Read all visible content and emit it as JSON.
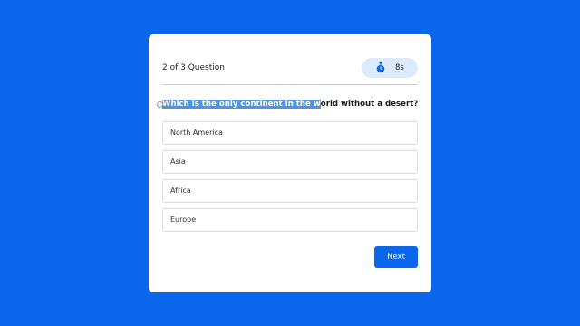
{
  "quiz": {
    "progress": "2 of 3 Question",
    "timer_value": "8s",
    "question": {
      "selected_part": "Which is the only continent in the w",
      "rest_part": "orld without a desert?"
    },
    "options": [
      "North America",
      "Asia",
      "Africa",
      "Europe"
    ],
    "next_label": "Next"
  },
  "colors": {
    "background": "#0a66ea",
    "timer_bg": "#dcebfb",
    "selection": "#4f93e6",
    "button": "#0a66ea"
  },
  "icons": {
    "timer": "stopwatch-icon"
  }
}
